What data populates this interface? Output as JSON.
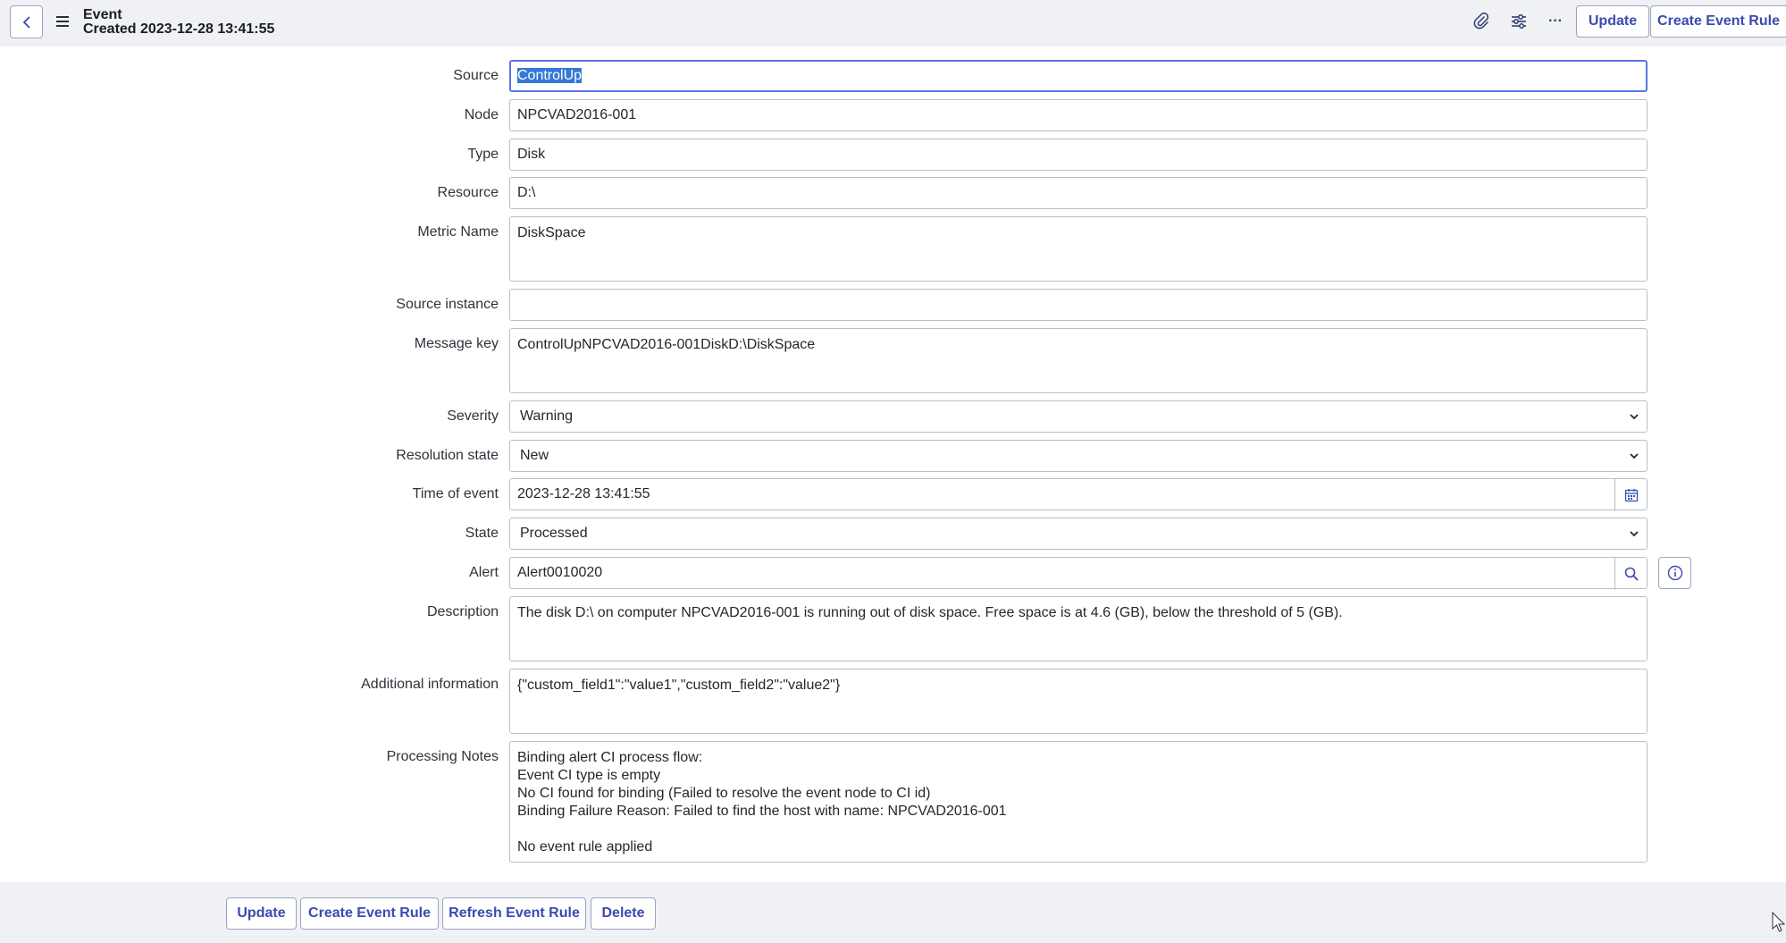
{
  "header": {
    "title": "Event",
    "subtitle": "Created 2023-12-28 13:41:55",
    "update_label": "Update",
    "create_rule_label": "Create Event Rule",
    "more_label": "···"
  },
  "fields": {
    "source": {
      "label": "Source",
      "value": "ControlUp"
    },
    "node": {
      "label": "Node",
      "value": "NPCVAD2016-001"
    },
    "type": {
      "label": "Type",
      "value": "Disk"
    },
    "resource": {
      "label": "Resource",
      "value": "D:\\"
    },
    "metric_name": {
      "label": "Metric Name",
      "value": "DiskSpace"
    },
    "source_instance": {
      "label": "Source instance",
      "value": ""
    },
    "message_key": {
      "label": "Message key",
      "value": "ControlUpNPCVAD2016-001DiskD:\\DiskSpace"
    },
    "severity": {
      "label": "Severity",
      "value": "Warning"
    },
    "resolution_state": {
      "label": "Resolution state",
      "value": "New"
    },
    "time_of_event": {
      "label": "Time of event",
      "value": "2023-12-28 13:41:55"
    },
    "state": {
      "label": "State",
      "value": "Processed"
    },
    "alert": {
      "label": "Alert",
      "value": "Alert0010020"
    },
    "description": {
      "label": "Description",
      "value": "The disk D:\\ on computer NPCVAD2016-001 is running out of disk space. Free space is at 4.6 (GB), below the threshold of 5 (GB)."
    },
    "additional_information": {
      "label": "Additional information",
      "value": "{\"custom_field1\":\"value1\",\"custom_field2\":\"value2\"}"
    },
    "processing_notes": {
      "label": "Processing Notes",
      "lines": [
        "Binding alert CI process flow:",
        "Event CI type is empty",
        "No CI found for binding (Failed to resolve the event node to CI id)",
        "Binding Failure Reason: Failed to find the host with name: NPCVAD2016-001",
        "",
        "No event rule applied"
      ]
    }
  },
  "footer": {
    "update_label": "Update",
    "create_rule_label": "Create Event Rule",
    "refresh_rule_label": "Refresh Event Rule",
    "delete_label": "Delete"
  },
  "colors": {
    "accent": "#3a4ab0",
    "focus_border": "#5975e2",
    "selection": "#3478d6",
    "header_bg": "#f0f1f4"
  }
}
